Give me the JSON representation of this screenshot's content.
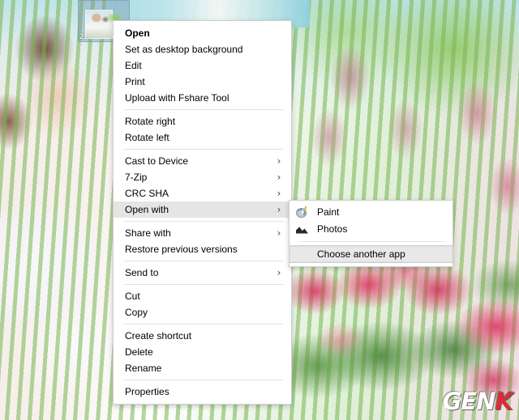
{
  "desktop": {
    "selected_file": {
      "icon": "image-thumbnail-icon",
      "label": "2..."
    },
    "watermark": {
      "text": "GEN",
      "accent_letter": "K",
      "accent_color": "#e02a3c"
    }
  },
  "context_menu": {
    "name": "file-context-menu",
    "groups": [
      {
        "items": [
          {
            "label": "Open",
            "bold": true,
            "has_submenu": false,
            "highlighted": false
          },
          {
            "label": "Set as desktop background",
            "bold": false,
            "has_submenu": false,
            "highlighted": false
          },
          {
            "label": "Edit",
            "bold": false,
            "has_submenu": false,
            "highlighted": false
          },
          {
            "label": "Print",
            "bold": false,
            "has_submenu": false,
            "highlighted": false
          },
          {
            "label": "Upload with Fshare Tool",
            "bold": false,
            "has_submenu": false,
            "highlighted": false
          }
        ]
      },
      {
        "items": [
          {
            "label": "Rotate right",
            "bold": false,
            "has_submenu": false,
            "highlighted": false
          },
          {
            "label": "Rotate left",
            "bold": false,
            "has_submenu": false,
            "highlighted": false
          }
        ]
      },
      {
        "items": [
          {
            "label": "Cast to Device",
            "bold": false,
            "has_submenu": true,
            "highlighted": false
          },
          {
            "label": "7-Zip",
            "bold": false,
            "has_submenu": true,
            "highlighted": false
          },
          {
            "label": "CRC SHA",
            "bold": false,
            "has_submenu": true,
            "highlighted": false
          },
          {
            "label": "Open with",
            "bold": false,
            "has_submenu": true,
            "highlighted": true
          }
        ]
      },
      {
        "items": [
          {
            "label": "Share with",
            "bold": false,
            "has_submenu": true,
            "highlighted": false
          },
          {
            "label": "Restore previous versions",
            "bold": false,
            "has_submenu": false,
            "highlighted": false
          }
        ]
      },
      {
        "items": [
          {
            "label": "Send to",
            "bold": false,
            "has_submenu": true,
            "highlighted": false
          }
        ]
      },
      {
        "items": [
          {
            "label": "Cut",
            "bold": false,
            "has_submenu": false,
            "highlighted": false
          },
          {
            "label": "Copy",
            "bold": false,
            "has_submenu": false,
            "highlighted": false
          }
        ]
      },
      {
        "items": [
          {
            "label": "Create shortcut",
            "bold": false,
            "has_submenu": false,
            "highlighted": false
          },
          {
            "label": "Delete",
            "bold": false,
            "has_submenu": false,
            "highlighted": false
          },
          {
            "label": "Rename",
            "bold": false,
            "has_submenu": false,
            "highlighted": false
          }
        ]
      },
      {
        "items": [
          {
            "label": "Properties",
            "bold": false,
            "has_submenu": false,
            "highlighted": false
          }
        ]
      }
    ],
    "submenu_arrow_glyph": "›"
  },
  "open_with_submenu": {
    "name": "open-with-submenu",
    "apps": [
      {
        "label": "Paint",
        "icon": "paint-icon"
      },
      {
        "label": "Photos",
        "icon": "photos-icon"
      }
    ],
    "footer": {
      "label": "Choose another app",
      "highlighted": true
    }
  },
  "colors": {
    "menu_background": "#ffffff",
    "menu_border": "#cfcfcf",
    "highlight": "#e5e5e5",
    "separator": "#e2e2e2",
    "text": "#000000"
  }
}
